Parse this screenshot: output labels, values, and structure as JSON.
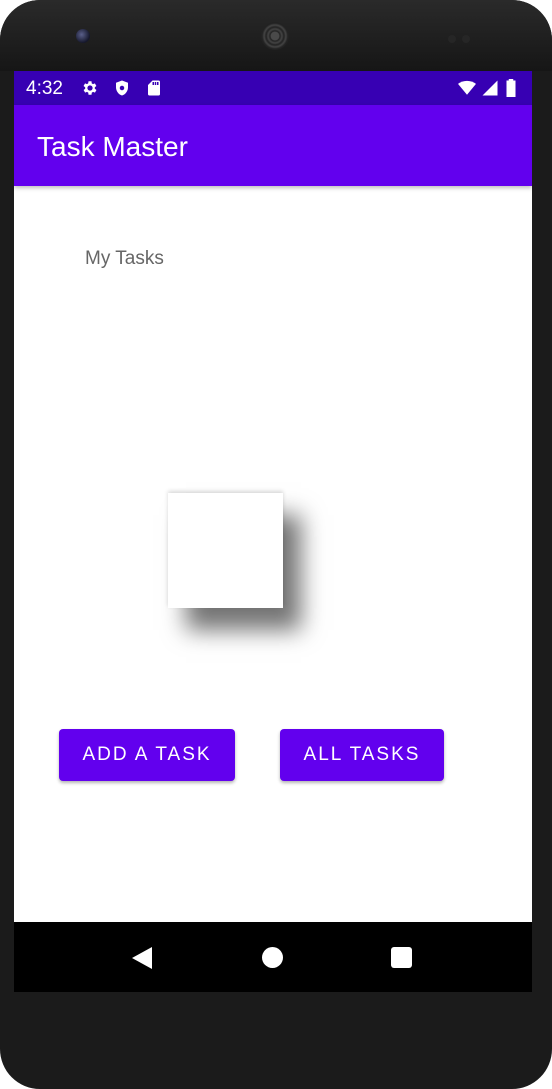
{
  "status_bar": {
    "time": "4:32",
    "icons_left": [
      "gear-icon",
      "shield-icon",
      "sd-card-icon"
    ],
    "icons_right": [
      "wifi-icon",
      "signal-icon",
      "battery-icon"
    ],
    "color": "#3700b3"
  },
  "app_bar": {
    "title": "Task Master",
    "color": "#6200ee"
  },
  "main": {
    "heading": "My Tasks",
    "add_task_label": "ADD A TASK",
    "all_tasks_label": "ALL TASKS",
    "button_color": "#6200ee"
  },
  "nav_bar": {
    "buttons": [
      "back-icon",
      "home-icon",
      "recents-icon"
    ]
  }
}
